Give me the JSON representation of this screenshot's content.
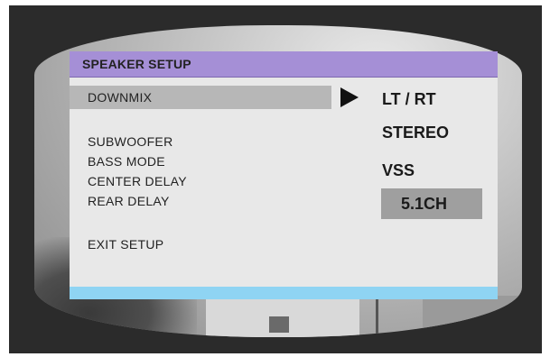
{
  "menu": {
    "title": "SPEAKER SETUP",
    "items": [
      {
        "label": "DOWNMIX"
      },
      {
        "label": "SUBWOOFER"
      },
      {
        "label": "BASS MODE"
      },
      {
        "label": "CENTER DELAY"
      },
      {
        "label": "REAR DELAY"
      },
      {
        "label": "EXIT SETUP"
      }
    ],
    "highlighted_item": "DOWNMIX"
  },
  "downmix_options": [
    {
      "label": "LT / RT"
    },
    {
      "label": "STEREO"
    },
    {
      "label": "VSS"
    },
    {
      "label": "5.1CH"
    }
  ],
  "selected_option": "5.1CH",
  "colors": {
    "header": "#a58fd6",
    "footer": "#8fd4f3",
    "panel": "#e8e8e8",
    "highlight": "#b7b7b7",
    "selected_option_bg": "#9f9f9f"
  },
  "icons": {
    "pointer": "triangle-right-icon"
  }
}
